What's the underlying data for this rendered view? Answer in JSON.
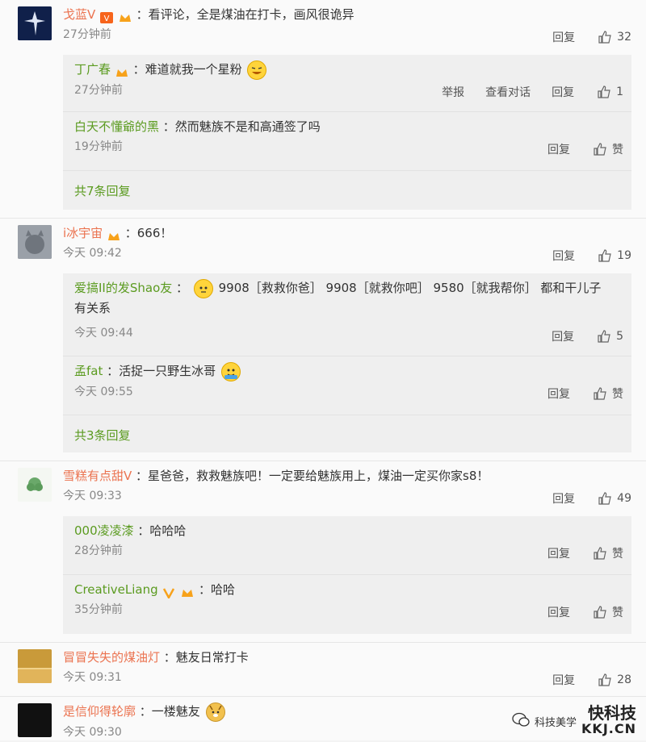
{
  "comments": [
    {
      "user": "戈蓝V",
      "text": "：看评论，全是煤油在打卡，画风很诡异",
      "time": "27分钟前",
      "reply_label": "回复",
      "likes": "32",
      "replies": [
        {
          "user": "丁广春",
          "text": "：难道就我一个星粉",
          "time": "27分钟前",
          "report": "举报",
          "view_conv": "查看对话",
          "reply_label": "回复",
          "likes": "1"
        },
        {
          "user": "白天不懂爺的黑",
          "text": "：然而魅族不是和高通签了吗",
          "time": "19分钟前",
          "reply_label": "回复",
          "likes": "赞"
        }
      ],
      "more": "共7条回复"
    },
    {
      "user": "i冰宇宙",
      "text": "：666！",
      "time": "今天 09:42",
      "reply_label": "回复",
      "likes": "19",
      "replies": [
        {
          "user": "爱搞II的发Shao友",
          "text": "：",
          "text2": "9908［救救你爸］ 9908［就救你吧］ 9580［就我帮你］ 都和干儿子",
          "text3": "有关系",
          "time": "今天 09:44",
          "reply_label": "回复",
          "likes": "5"
        },
        {
          "user": "孟fat",
          "text": "：活捉一只野生冰哥",
          "time": "今天 09:55",
          "reply_label": "回复",
          "likes": "赞"
        }
      ],
      "more": "共3条回复"
    },
    {
      "user": "雪糕有点甜V",
      "text": "：星爸爸，救救魅族吧！一定要给魅族用上，煤油一定买你家s8！",
      "time": "今天 09:33",
      "reply_label": "回复",
      "likes": "49",
      "replies": [
        {
          "user": "000凌凌漆",
          "text": "：哈哈哈",
          "time": "28分钟前",
          "reply_label": "回复",
          "likes": "赞"
        },
        {
          "user": "CreativeLiang",
          "text": "：哈哈",
          "time": "35分钟前",
          "reply_label": "回复",
          "likes": "赞"
        }
      ]
    },
    {
      "user": "冒冒失失的煤油灯",
      "text": "：魅友日常打卡",
      "time": "今天 09:31",
      "reply_label": "回复",
      "likes": "28"
    },
    {
      "user": "是信仰得轮廓",
      "text": "：一楼魅友",
      "time": "今天 09:30"
    }
  ],
  "watermark": {
    "line1": "快科技",
    "line2": "KKJ.CN",
    "line3": "科技美学"
  },
  "colors": {
    "username": "#eb7350",
    "reply_user": "#5b9b20"
  }
}
